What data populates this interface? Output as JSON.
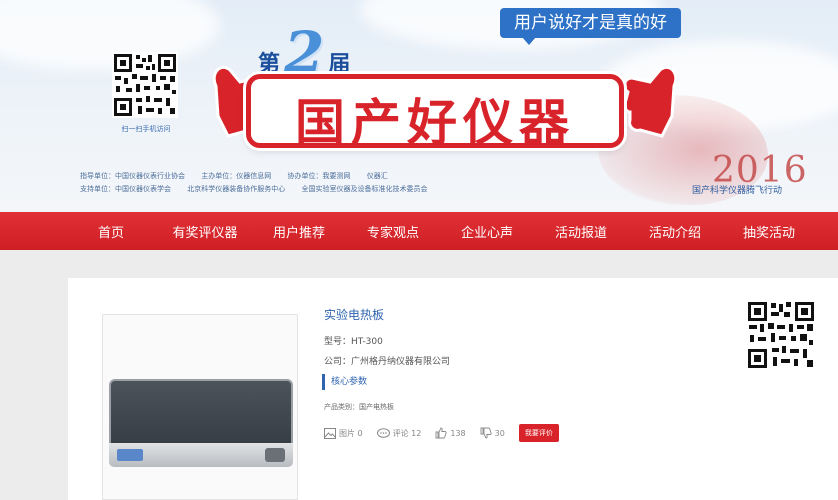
{
  "header": {
    "slogan": "用户说好才是真的好",
    "edition_prefix": "第",
    "edition_number": "2",
    "edition_suffix": "届",
    "main_title": "国产好仪器",
    "qr_caption": "扫一扫手机访问",
    "year": "2016",
    "year_caption": "国产科学仪器腾飞行动",
    "org_line_1": [
      "指导单位：中国仪器仪表行业协会",
      "主办单位：仪器信息网",
      "协办单位：我要测网",
      "仪器汇"
    ],
    "org_line_2": [
      "支持单位：中国仪器仪表学会",
      "北京科学仪器装备协作服务中心",
      "全国实验室仪器及设备标准化技术委员会"
    ]
  },
  "nav": {
    "items": [
      "首页",
      "有奖评仪器",
      "用户推荐",
      "专家观点",
      "企业心声",
      "活动报道",
      "活动介绍",
      "抽奖活动"
    ]
  },
  "product": {
    "title": "实验电热板",
    "model": "型号：HT-300",
    "company": "公司：广州格丹纳仪器有限公司",
    "core_params": "核心参数",
    "category": "产品类别：国产电热板",
    "stats": {
      "images": "图片 0",
      "comments": "评论 12",
      "likes": "138",
      "dislikes": "30"
    },
    "review_button": "我要评价"
  },
  "colors": {
    "brand_red": "#d8232a",
    "brand_blue": "#2d72c7",
    "link_blue": "#2f64b0"
  }
}
